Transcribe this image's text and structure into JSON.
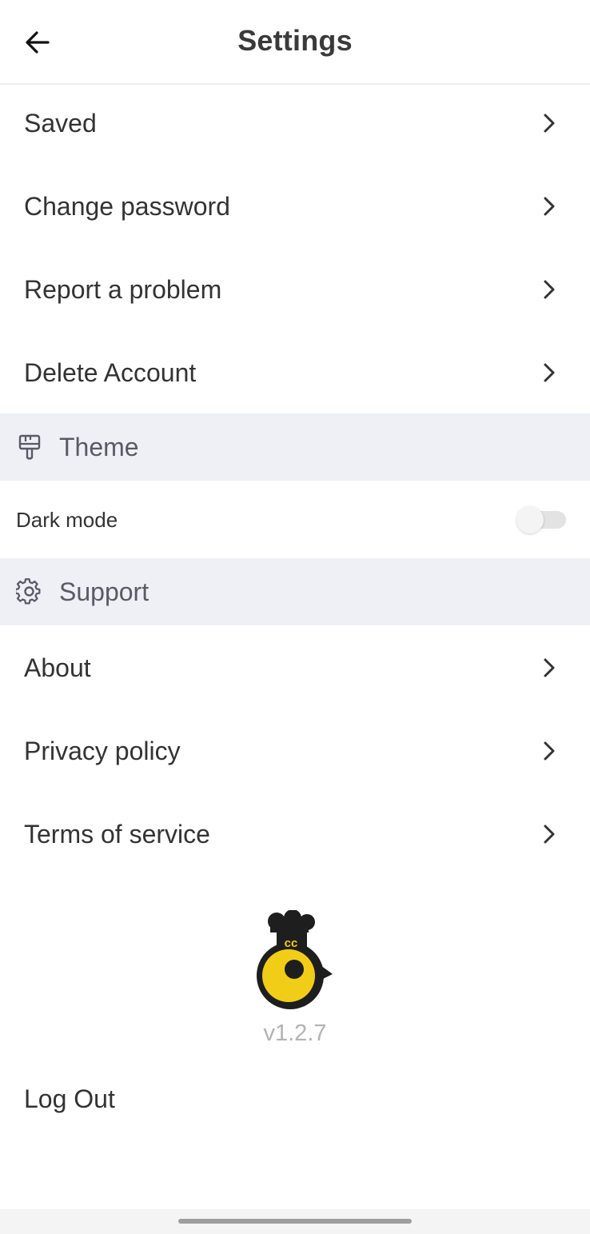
{
  "header": {
    "title": "Settings",
    "back_icon": "arrow-left-icon"
  },
  "account_items": [
    {
      "label": "Saved"
    },
    {
      "label": "Change password"
    },
    {
      "label": "Report a problem"
    },
    {
      "label": "Delete Account"
    }
  ],
  "theme_section": {
    "label": "Theme",
    "icon": "paint-brush-icon",
    "dark_mode": {
      "label": "Dark mode",
      "enabled": false
    }
  },
  "support_section": {
    "label": "Support",
    "icon": "gear-icon",
    "items": [
      {
        "label": "About"
      },
      {
        "label": "Privacy policy"
      },
      {
        "label": "Terms of service"
      }
    ]
  },
  "footer": {
    "logo_text": "cc",
    "version": "v1.2.7",
    "logout_label": "Log Out"
  },
  "colors": {
    "section_bg": "#eff0f6",
    "logo_yellow": "#f2cd17",
    "logo_dark": "#1e1e1e",
    "version_text": "#b3b3b3"
  }
}
